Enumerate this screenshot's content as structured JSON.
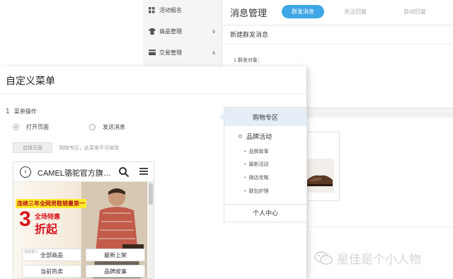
{
  "admin": {
    "sidebar": {
      "items": [
        {
          "label": "活动报名",
          "icon": "grid-icon",
          "chevron": ""
        },
        {
          "label": "商品管理",
          "icon": "shirt-icon",
          "chevron": "∨"
        },
        {
          "label": "交易管理",
          "icon": "card-icon",
          "chevron": "∧"
        }
      ]
    },
    "header": {
      "title": "消息管理",
      "tabs": [
        "群发消息",
        "关注回复",
        "自动回复"
      ],
      "active_tab": "群发消息"
    },
    "section_title": "新建群发消息",
    "target_label": "1 群发对象："
  },
  "dialog": {
    "title": "自定义菜单",
    "step_number": "1",
    "step_label": "菜单操作",
    "radio_open_page": "打开页面",
    "radio_send_message": "发送消息",
    "select_page_button": "选择页面",
    "hint": "购物专区，此菜单不可修改",
    "phone": {
      "back_icon": "back-arrow-icon",
      "title": "CAMEL骆驼官方旗…",
      "search_icon": "search-icon",
      "menu_icon": "hamburger-icon",
      "banner": {
        "headline": "连续三年全网男鞋销量第一",
        "big_number": "3",
        "small_text": "全场特惠",
        "zhe": "折起"
      },
      "buttons": [
        "全部商品",
        "最新上架",
        "当前热卖",
        "品牌故事"
      ],
      "small_label": "点击进入"
    },
    "menu": {
      "active": "购物专区",
      "parent": "品牌活动",
      "children": [
        "品牌故事",
        "最新活动",
        "微店攻略",
        "鞋包护理"
      ],
      "footer": "个人中心"
    }
  },
  "watermark": {
    "text": "星佳是个小人物",
    "icon": "wechat-icon"
  },
  "colors": {
    "accent_blue": "#3ea6e4",
    "promo_red": "#d8121d",
    "promo_yellow": "#ffeb2c",
    "menu_highlight": "#e5eef6"
  }
}
